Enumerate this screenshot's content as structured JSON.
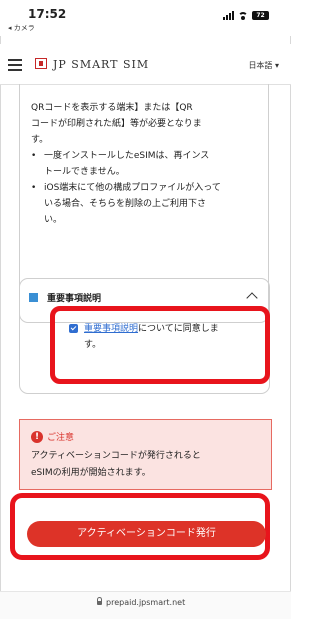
{
  "status_bar": {
    "time": "17:52",
    "back_label": "◂ カメラ",
    "battery": "72"
  },
  "header": {
    "brand": "JP SMART SIM",
    "language": "日本語 ▾"
  },
  "notes": {
    "lines": [
      "QRコードを表示する端末】または【QR",
      "コードが印刷された紙】等が必要となりま",
      "す。"
    ],
    "bullets": [
      {
        "line1": "一度インストールしたeSIMは、再インス",
        "line2": "トールできません。"
      },
      {
        "line1": "iOS端末にて他の構成プロファイルが入って",
        "line2": "いる場合、そちらを削除の上ご利用下さ",
        "line3": "い。"
      }
    ]
  },
  "important": {
    "title": "重要事項説明",
    "agree_link": "重要事項説明",
    "agree_text": "についてに同意しま",
    "agree_text2": "す。"
  },
  "notice": {
    "title": "ご注意",
    "line1": "アクティベーションコードが発行されると",
    "line2": "eSIMの利用が開始されます。"
  },
  "cta": {
    "label": "アクティベーションコード発行"
  },
  "url_bar": {
    "url": "prepaid.jpsmart.net"
  },
  "colors": {
    "accent_red": "#dd3328",
    "highlight_red": "#e8141c",
    "link_blue": "#2f6dd0",
    "notice_bg": "#fbe3e1"
  }
}
